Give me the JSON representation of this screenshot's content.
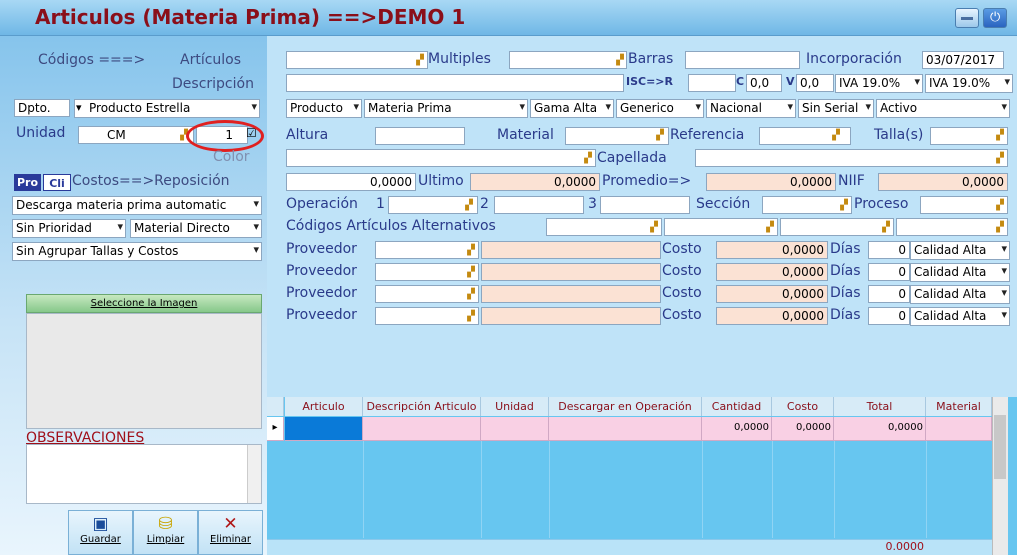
{
  "window": {
    "title": "Articulos (Materia Prima) ==>DEMO 1"
  },
  "left": {
    "codigos_label": "Códigos ===>",
    "articulos_label": "Artículos",
    "descripcion_label": "Descripción",
    "dpto_label": "Dpto.",
    "dpto_value": "Producto Estrella",
    "unidad_label": "Unidad",
    "unidad_value": "CM",
    "unidad_qty": "1",
    "unidad_checked": "☑",
    "color_label": "Color",
    "pro_tab": "Pro",
    "cli_tab": "Cli",
    "costos_label": "Costos==>Reposición",
    "descarga_value": "Descarga materia prima automatic",
    "prioridad_value": "Sin Prioridad",
    "material_value": "Material Directo",
    "agrupar_value": "Sin Agrupar Tallas y Costos",
    "imagen_label": "Seleccione la Imagen",
    "observaciones_label": "OBSERVACIONES"
  },
  "top": {
    "multiples_label": "Multiples",
    "barras_label": "Barras",
    "incorporacion_label": "Incorporación",
    "incorporacion_value": "03/07/2017",
    "isc_label": "ISC=>R",
    "c_label": "C",
    "c_value": "0,0",
    "v_label": "V",
    "v_value": "0,0",
    "iva1": "IVA 19.0%",
    "iva2": "IVA 19.0%"
  },
  "classif": {
    "producto": "Producto",
    "materia": "Materia Prima",
    "gama": "Gama Alta",
    "generico": "Generico",
    "nacional": "Nacional",
    "serial": "Sin Serial",
    "activo": "Activo"
  },
  "attrs": {
    "altura": "Altura",
    "material": "Material",
    "referencia": "Referencia",
    "talla": "Talla(s)",
    "capellada": "Capellada"
  },
  "costs": {
    "value1": "0,0000",
    "ultimo_label": "Ultimo",
    "ultimo_value": "0,0000",
    "promedio_label": "Promedio=>",
    "promedio_value": "0,0000",
    "niif_label": "NIIF",
    "niif_value": "0,0000"
  },
  "ops": {
    "operacion_label": "Operación",
    "n1": "1",
    "n2": "2",
    "n3": "3",
    "seccion_label": "Sección",
    "proceso_label": "Proceso"
  },
  "alternativos_label": "Códigos Artículos Alternativos",
  "proveedores": [
    {
      "label": "Proveedor",
      "costo_label": "Costo",
      "costo": "0,0000",
      "dias_label": "Días",
      "dias": "0",
      "calidad": "Calidad Alta"
    },
    {
      "label": "Proveedor",
      "costo_label": "Costo",
      "costo": "0,0000",
      "dias_label": "Días",
      "dias": "0",
      "calidad": "Calidad Alta"
    },
    {
      "label": "Proveedor",
      "costo_label": "Costo",
      "costo": "0,0000",
      "dias_label": "Días",
      "dias": "0",
      "calidad": "Calidad Alta"
    },
    {
      "label": "Proveedor",
      "costo_label": "Costo",
      "costo": "0,0000",
      "dias_label": "Días",
      "dias": "0",
      "calidad": "Calidad Alta"
    }
  ],
  "grid": {
    "headers": [
      "Articulo",
      "Descripción Articulo",
      "Unidad",
      "Descargar en Operación",
      "Cantidad",
      "Costo",
      "Total",
      "Material"
    ],
    "row": {
      "cantidad": "0,0000",
      "costo": "0,0000",
      "total": "0,0000"
    },
    "footer_total": "0.0000"
  },
  "buttons": {
    "guardar": "Guardar",
    "limpiar": "Limpiar",
    "eliminar": "Eliminar"
  },
  "colors": {
    "title": "#8a0f1a",
    "accent": "#2a3a8a",
    "peach": "#fbe2d4",
    "grid_row": "#f9d0e4",
    "grid_bg": "#67c6f0"
  }
}
